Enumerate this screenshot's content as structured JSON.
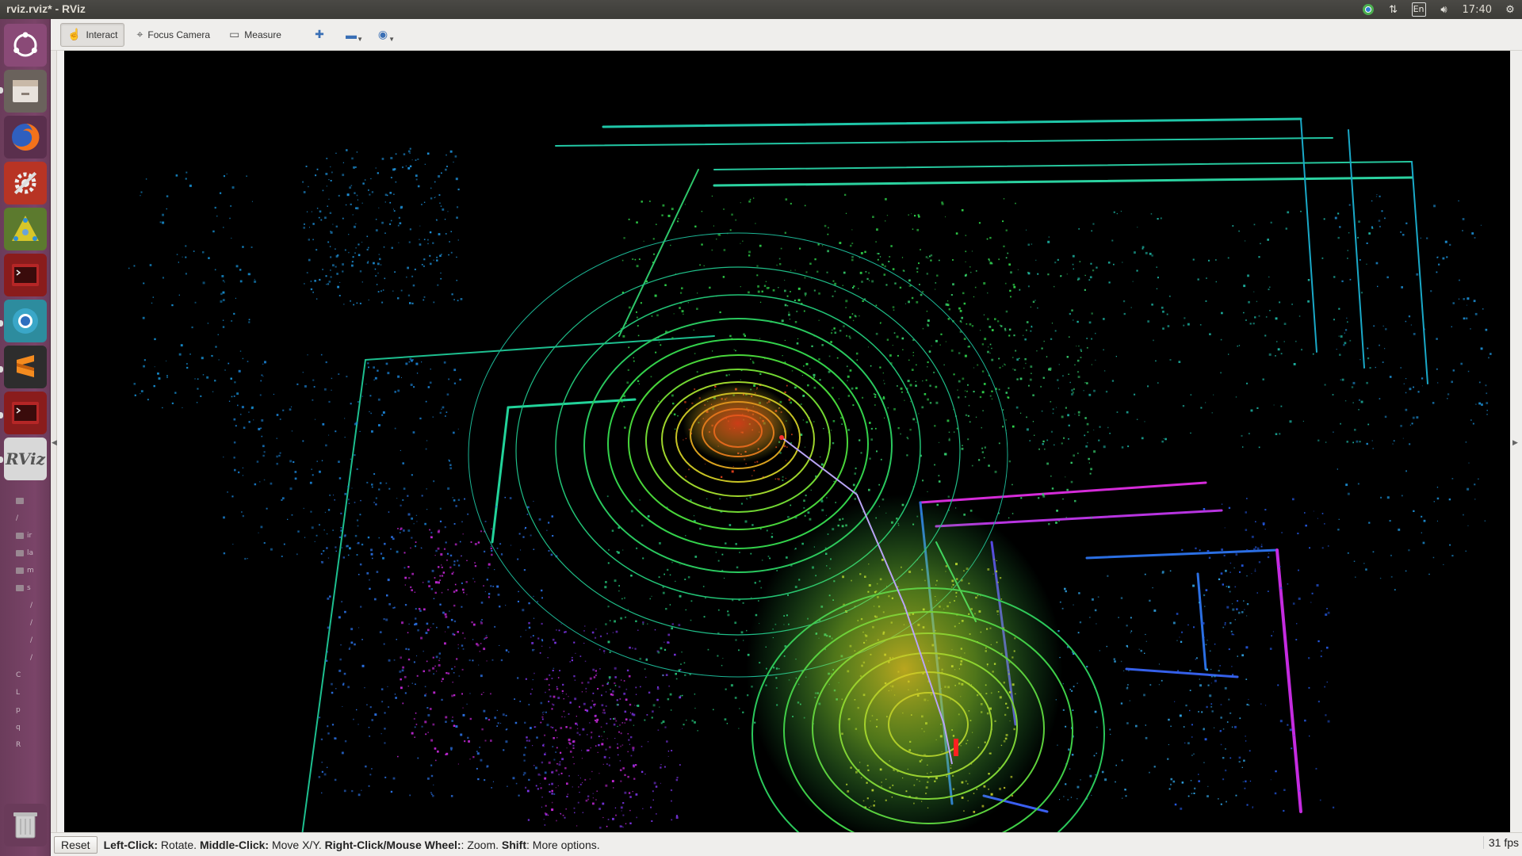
{
  "window": {
    "title": "rviz.rviz* - RViz"
  },
  "tray": {
    "clock": "17:40",
    "lang": "En"
  },
  "toolbar": {
    "interact": "Interact",
    "focus_camera": "Focus Camera",
    "measure": "Measure"
  },
  "launcher": {
    "items": [
      {
        "name": "ubuntu-dash-icon",
        "color": "#7d3f6b"
      },
      {
        "name": "files-icon",
        "color": "#5f5a55"
      },
      {
        "name": "firefox-icon",
        "color": "#e66000"
      },
      {
        "name": "system-settings-icon",
        "color": "#c73a2a"
      },
      {
        "name": "ros-network-icon",
        "color": "#6f8f3a"
      },
      {
        "name": "terminal-icon",
        "color": "#8a1c1c"
      },
      {
        "name": "chromium-icon",
        "color": "#2d8c9e"
      },
      {
        "name": "sublime-text-icon",
        "color": "#e07a10"
      },
      {
        "name": "terminal-2-icon",
        "color": "#8a1c1c"
      },
      {
        "name": "rviz-icon",
        "color": "#3d3d3d",
        "label": "RViz"
      }
    ],
    "trash": "trash-icon"
  },
  "tree_peek": {
    "rows": [
      "/",
      "ir",
      "la",
      "m",
      "s",
      "/",
      "/",
      "/",
      "/",
      "C",
      "L",
      "p",
      "q",
      "R"
    ]
  },
  "status": {
    "reset": "Reset",
    "help_parts": [
      {
        "b": "Left-Click:",
        "t": " Rotate. "
      },
      {
        "b": "Middle-Click:",
        "t": " Move X/Y. "
      },
      {
        "b": "Right-Click/Mouse Wheel:",
        "t": ": Zoom. "
      },
      {
        "b": "Shift",
        "t": ": More options."
      }
    ],
    "fps": "31 fps"
  },
  "colors": {
    "viewport_bg": "#000000",
    "cloud_green": "#2fd24a",
    "cloud_cyan": "#19c9b0",
    "cloud_blue": "#2a6fe0",
    "cloud_magenta": "#c227d6",
    "cloud_yellow": "#d7d426",
    "cloud_red": "#e0401a"
  }
}
